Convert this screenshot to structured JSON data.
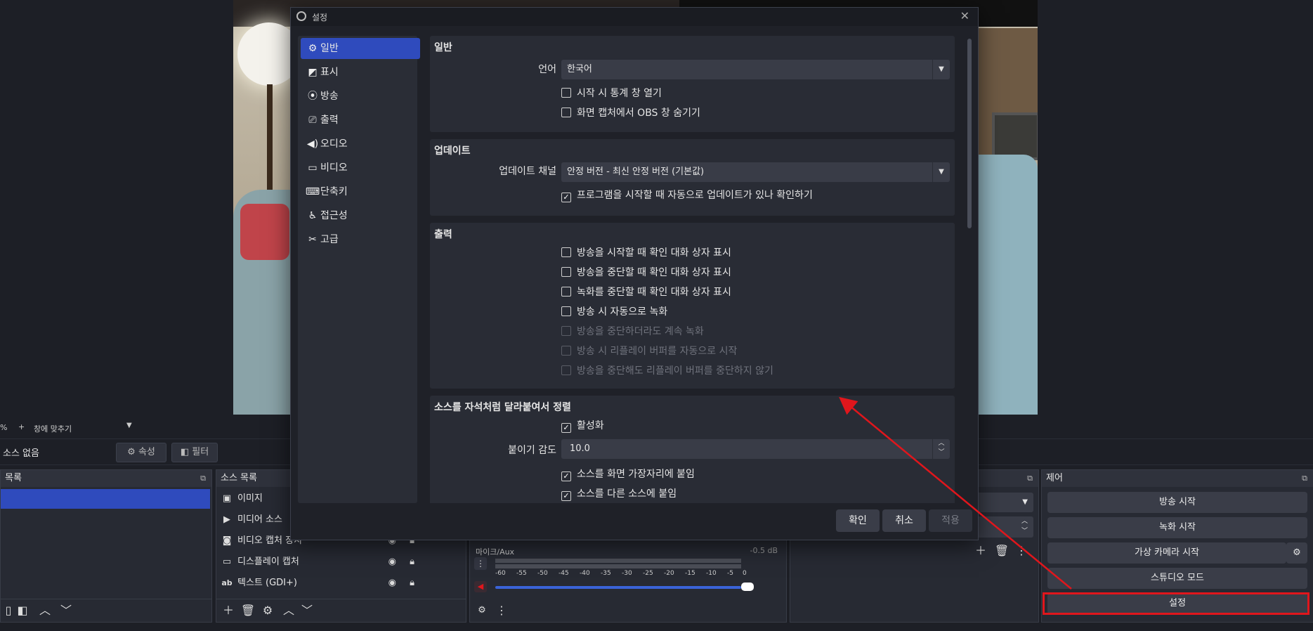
{
  "preview": {
    "caption": ""
  },
  "toolbar": {
    "zoom_percent": "%",
    "plus": "+",
    "fit_label": "창에 맞추기"
  },
  "context_bar": {
    "no_source": "소스 없음",
    "properties_label": "속성",
    "filters_label": "필터"
  },
  "docks": {
    "scenes": {
      "title": "목록"
    },
    "sources": {
      "title": "소스 목록",
      "items": [
        {
          "label": "이미지",
          "icon": "image-icon"
        },
        {
          "label": "미디어 소스",
          "icon": "play-icon"
        },
        {
          "label": "비디오 캡처 장치",
          "icon": "camera-icon"
        },
        {
          "label": "디스플레이 캡처",
          "icon": "monitor-icon"
        },
        {
          "label": "텍스트 (GDI+)",
          "icon": "text-icon"
        }
      ]
    },
    "mixer": {
      "channel": "마이크/Aux",
      "level": "-0.5 dB",
      "ticks": [
        "-60",
        "-55",
        "-50",
        "-45",
        "-40",
        "-35",
        "-30",
        "-25",
        "-20",
        "-15",
        "-10",
        "-5",
        "0"
      ]
    },
    "controls": {
      "title": "제어",
      "buttons": [
        "방송 시작",
        "녹화 시작",
        "가상 카메라 시작",
        "스튜디오 모드",
        "설정"
      ]
    }
  },
  "dialog": {
    "title": "설정",
    "nav": [
      {
        "label": "일반",
        "icon": "gear-icon",
        "active": true
      },
      {
        "label": "표시",
        "icon": "display-icon",
        "active": false
      },
      {
        "label": "방송",
        "icon": "broadcast-icon",
        "active": false
      },
      {
        "label": "출력",
        "icon": "output-icon",
        "active": false
      },
      {
        "label": "오디오",
        "icon": "speaker-icon",
        "active": false
      },
      {
        "label": "비디오",
        "icon": "video-icon",
        "active": false
      },
      {
        "label": "단축키",
        "icon": "keyboard-icon",
        "active": false
      },
      {
        "label": "접근성",
        "icon": "accessibility-icon",
        "active": false
      },
      {
        "label": "고급",
        "icon": "tools-icon",
        "active": false
      }
    ],
    "general": {
      "title": "일반",
      "language_label": "언어",
      "language_value": "한국어",
      "open_stats_on_start": "시작 시 통계 창 열기",
      "hide_obs_from_capture": "화면 캡처에서 OBS 창 숨기기"
    },
    "update": {
      "title": "업데이트",
      "channel_label": "업데이트 채널",
      "channel_value": "안정 버전 - 최신 안정 버전 (기본값)",
      "auto_check": "프로그램을 시작할 때 자동으로 업데이트가 있나 확인하기"
    },
    "output": {
      "title": "출력",
      "options": [
        {
          "label": "방송을 시작할 때 확인 대화 상자 표시",
          "disabled": false
        },
        {
          "label": "방송을 중단할 때 확인 대화 상자 표시",
          "disabled": false
        },
        {
          "label": "녹화를 중단할 때 확인 대화 상자 표시",
          "disabled": false
        },
        {
          "label": "방송 시 자동으로 녹화",
          "disabled": false
        },
        {
          "label": "방송을 중단하더라도 계속 녹화",
          "disabled": true
        },
        {
          "label": "방송 시 리플레이 버퍼를 자동으로 시작",
          "disabled": true
        },
        {
          "label": "방송을 중단해도 리플레이 버퍼를 중단하지 않기",
          "disabled": true
        }
      ]
    },
    "snapping": {
      "title": "소스를 자석처럼 달라붙여서 정렬",
      "enable": "활성화",
      "sensitivity_label": "붙이기 감도",
      "sensitivity_value": "10.0",
      "snap_to_edges": "소스를 화면 가장자리에 붙임",
      "snap_to_sources": "소스를 다른 소스에 붙임"
    },
    "buttons": {
      "ok": "확인",
      "cancel": "취소",
      "apply": "적용"
    }
  },
  "colors": {
    "accent": "#2f4bbd",
    "annotation": "#e0161c",
    "dialog_bg": "#1f2128",
    "panel_bg": "#292c35"
  }
}
